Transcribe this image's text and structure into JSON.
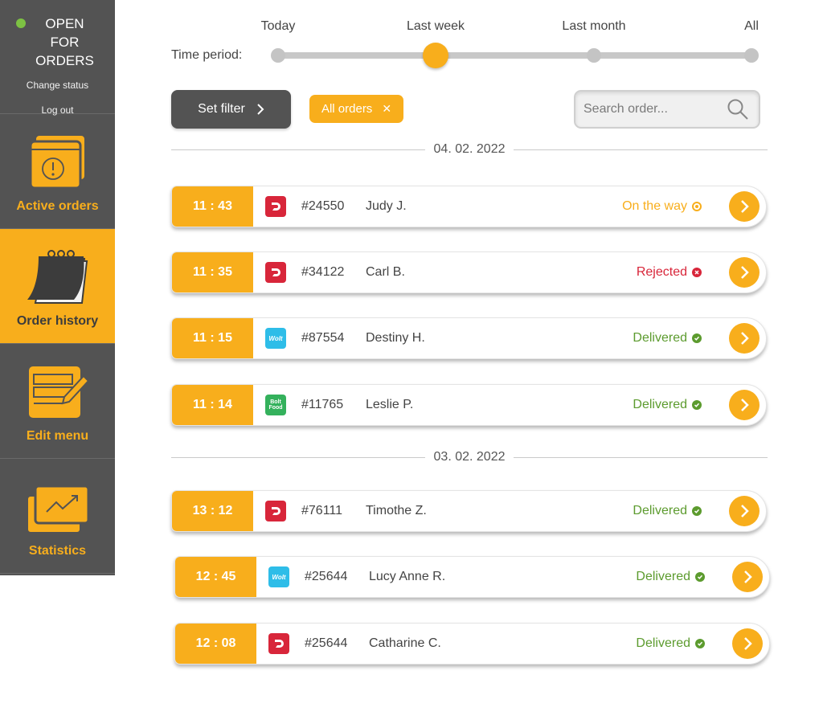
{
  "colors": {
    "accent": "#f8ae1c",
    "sidebar": "#535353",
    "online": "#7dc243",
    "on_the_way": "#f8ae1c",
    "rejected": "#d8263a",
    "delivered": "#5c9b2e",
    "foodora": "#d8263a",
    "wolt": "#2ebde8",
    "bolt": "#34b15c"
  },
  "sidebar": {
    "status": "OPEN FOR ORDERS",
    "change_status": "Change status",
    "log_out": "Log out",
    "items": [
      {
        "label": "Active orders",
        "icon": "active-orders-icon"
      },
      {
        "label": "Order history",
        "icon": "calendar-icon",
        "active": true
      },
      {
        "label": "Edit menu",
        "icon": "edit-menu-icon"
      },
      {
        "label": "Statistics",
        "icon": "statistics-icon"
      }
    ]
  },
  "time_period": {
    "label": "Time period:",
    "options": [
      "Today",
      "Last week",
      "Last month",
      "All"
    ],
    "selected": "Last week"
  },
  "filter": {
    "set_filter_label": "Set filter",
    "chip_label": "All orders"
  },
  "search": {
    "placeholder": "Search order..."
  },
  "groups": [
    {
      "date": "04. 02. 2022",
      "orders": [
        {
          "time": "11 : 43",
          "platform": "foodora",
          "number": "#24550",
          "name": "Judy J.",
          "status": "On the way",
          "state": "on_the_way"
        },
        {
          "time": "11 : 35",
          "platform": "foodora",
          "number": "#34122",
          "name": "Carl B.",
          "status": "Rejected",
          "state": "rejected"
        },
        {
          "time": "11 : 15",
          "platform": "wolt",
          "number": "#87554",
          "name": "Destiny H.",
          "status": "Delivered",
          "state": "delivered"
        },
        {
          "time": "11 : 14",
          "platform": "bolt",
          "number": "#11765",
          "name": "Leslie P.",
          "status": "Delivered",
          "state": "delivered"
        }
      ]
    },
    {
      "date": "03. 02. 2022",
      "orders": [
        {
          "time": "13 : 12",
          "platform": "foodora",
          "number": "#76111",
          "name": "Timothe Z.",
          "status": "Delivered",
          "state": "delivered"
        },
        {
          "time": "12 : 45",
          "platform": "wolt",
          "number": "#25644",
          "name": "Lucy Anne R.",
          "status": "Delivered",
          "state": "delivered"
        },
        {
          "time": "12 : 08",
          "platform": "foodora",
          "number": "#25644",
          "name": "Catharine C.",
          "status": "Delivered",
          "state": "delivered"
        }
      ]
    }
  ],
  "logos": {
    "wolt": "Wolt",
    "bolt_line1": "Bolt",
    "bolt_line2": "Food"
  }
}
